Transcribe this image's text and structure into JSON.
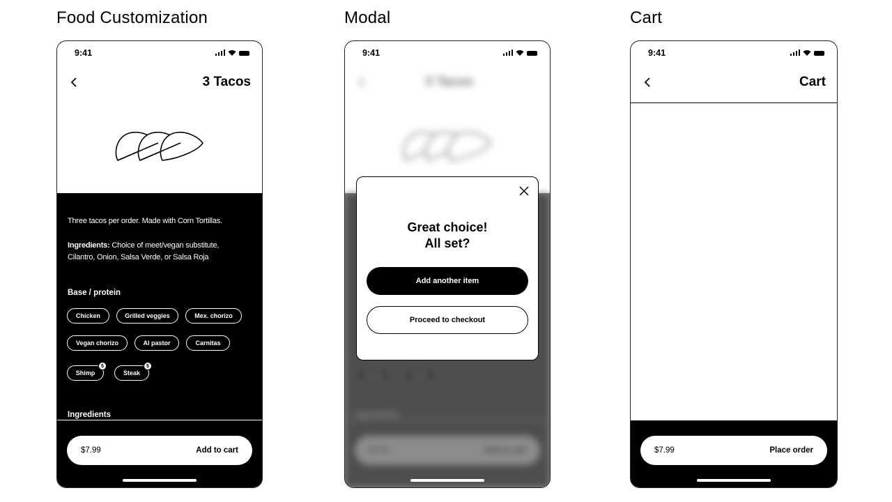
{
  "sections": {
    "customization_title": "Food Customization",
    "modal_title": "Modal",
    "cart_title": "Cart"
  },
  "status_bar": {
    "time": "9:41"
  },
  "food": {
    "title": "3 Tacos",
    "description": "Three tacos per order. Made with Corn Tortillas.",
    "ingredients_label": "Ingredients:",
    "ingredients_text": "Choice of meet/vegan substitute, Cilantro, Onion, Salsa Verde, or Salsa Roja",
    "base_label": "Base / protein",
    "options": [
      "Chicken",
      "Grilled veggies",
      "Mex. chorizo",
      "Vegan chorizo",
      "Al pastor",
      "Carnitas",
      "Shimp",
      "Steak"
    ],
    "premium_badge": "$",
    "section_ingredients": "Ingredients",
    "price": "$7.99",
    "add_to_cart": "Add to cart"
  },
  "modal": {
    "heading_line1": "Great choice!",
    "heading_line2": "All set?",
    "primary_button": "Add another item",
    "secondary_button": "Proceed to checkout"
  },
  "cart": {
    "title": "Cart",
    "price": "$7.99",
    "place_order": "Place order"
  }
}
